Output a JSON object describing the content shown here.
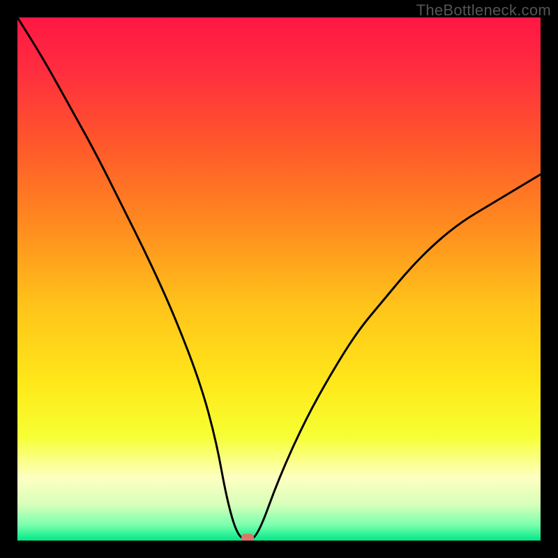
{
  "watermark": "TheBottleneck.com",
  "chart_data": {
    "type": "line",
    "title": "",
    "xlabel": "",
    "ylabel": "",
    "xlim": [
      0,
      100
    ],
    "ylim": [
      0,
      100
    ],
    "series": [
      {
        "name": "bottleneck-curve",
        "x": [
          0,
          5,
          10,
          15,
          20,
          25,
          30,
          35,
          38,
          40,
          42,
          44,
          46,
          50,
          55,
          60,
          65,
          70,
          75,
          80,
          85,
          90,
          95,
          100
        ],
        "values": [
          100,
          92,
          83,
          74,
          64,
          54,
          43,
          30,
          19,
          8,
          1,
          0,
          1,
          12,
          23,
          32,
          40,
          46,
          52,
          57,
          61,
          64,
          67,
          70
        ]
      }
    ],
    "marker": {
      "x": 44,
      "y": 0.5
    },
    "gradient_stops": [
      {
        "offset": 0.0,
        "color": "#ff1744"
      },
      {
        "offset": 0.1,
        "color": "#ff2d3f"
      },
      {
        "offset": 0.25,
        "color": "#ff5a2a"
      },
      {
        "offset": 0.4,
        "color": "#ff8c1f"
      },
      {
        "offset": 0.55,
        "color": "#ffc31a"
      },
      {
        "offset": 0.7,
        "color": "#ffe81a"
      },
      {
        "offset": 0.8,
        "color": "#f6ff33"
      },
      {
        "offset": 0.88,
        "color": "#fdffc2"
      },
      {
        "offset": 0.93,
        "color": "#d9ffba"
      },
      {
        "offset": 0.97,
        "color": "#7affad"
      },
      {
        "offset": 1.0,
        "color": "#00e889"
      }
    ]
  }
}
